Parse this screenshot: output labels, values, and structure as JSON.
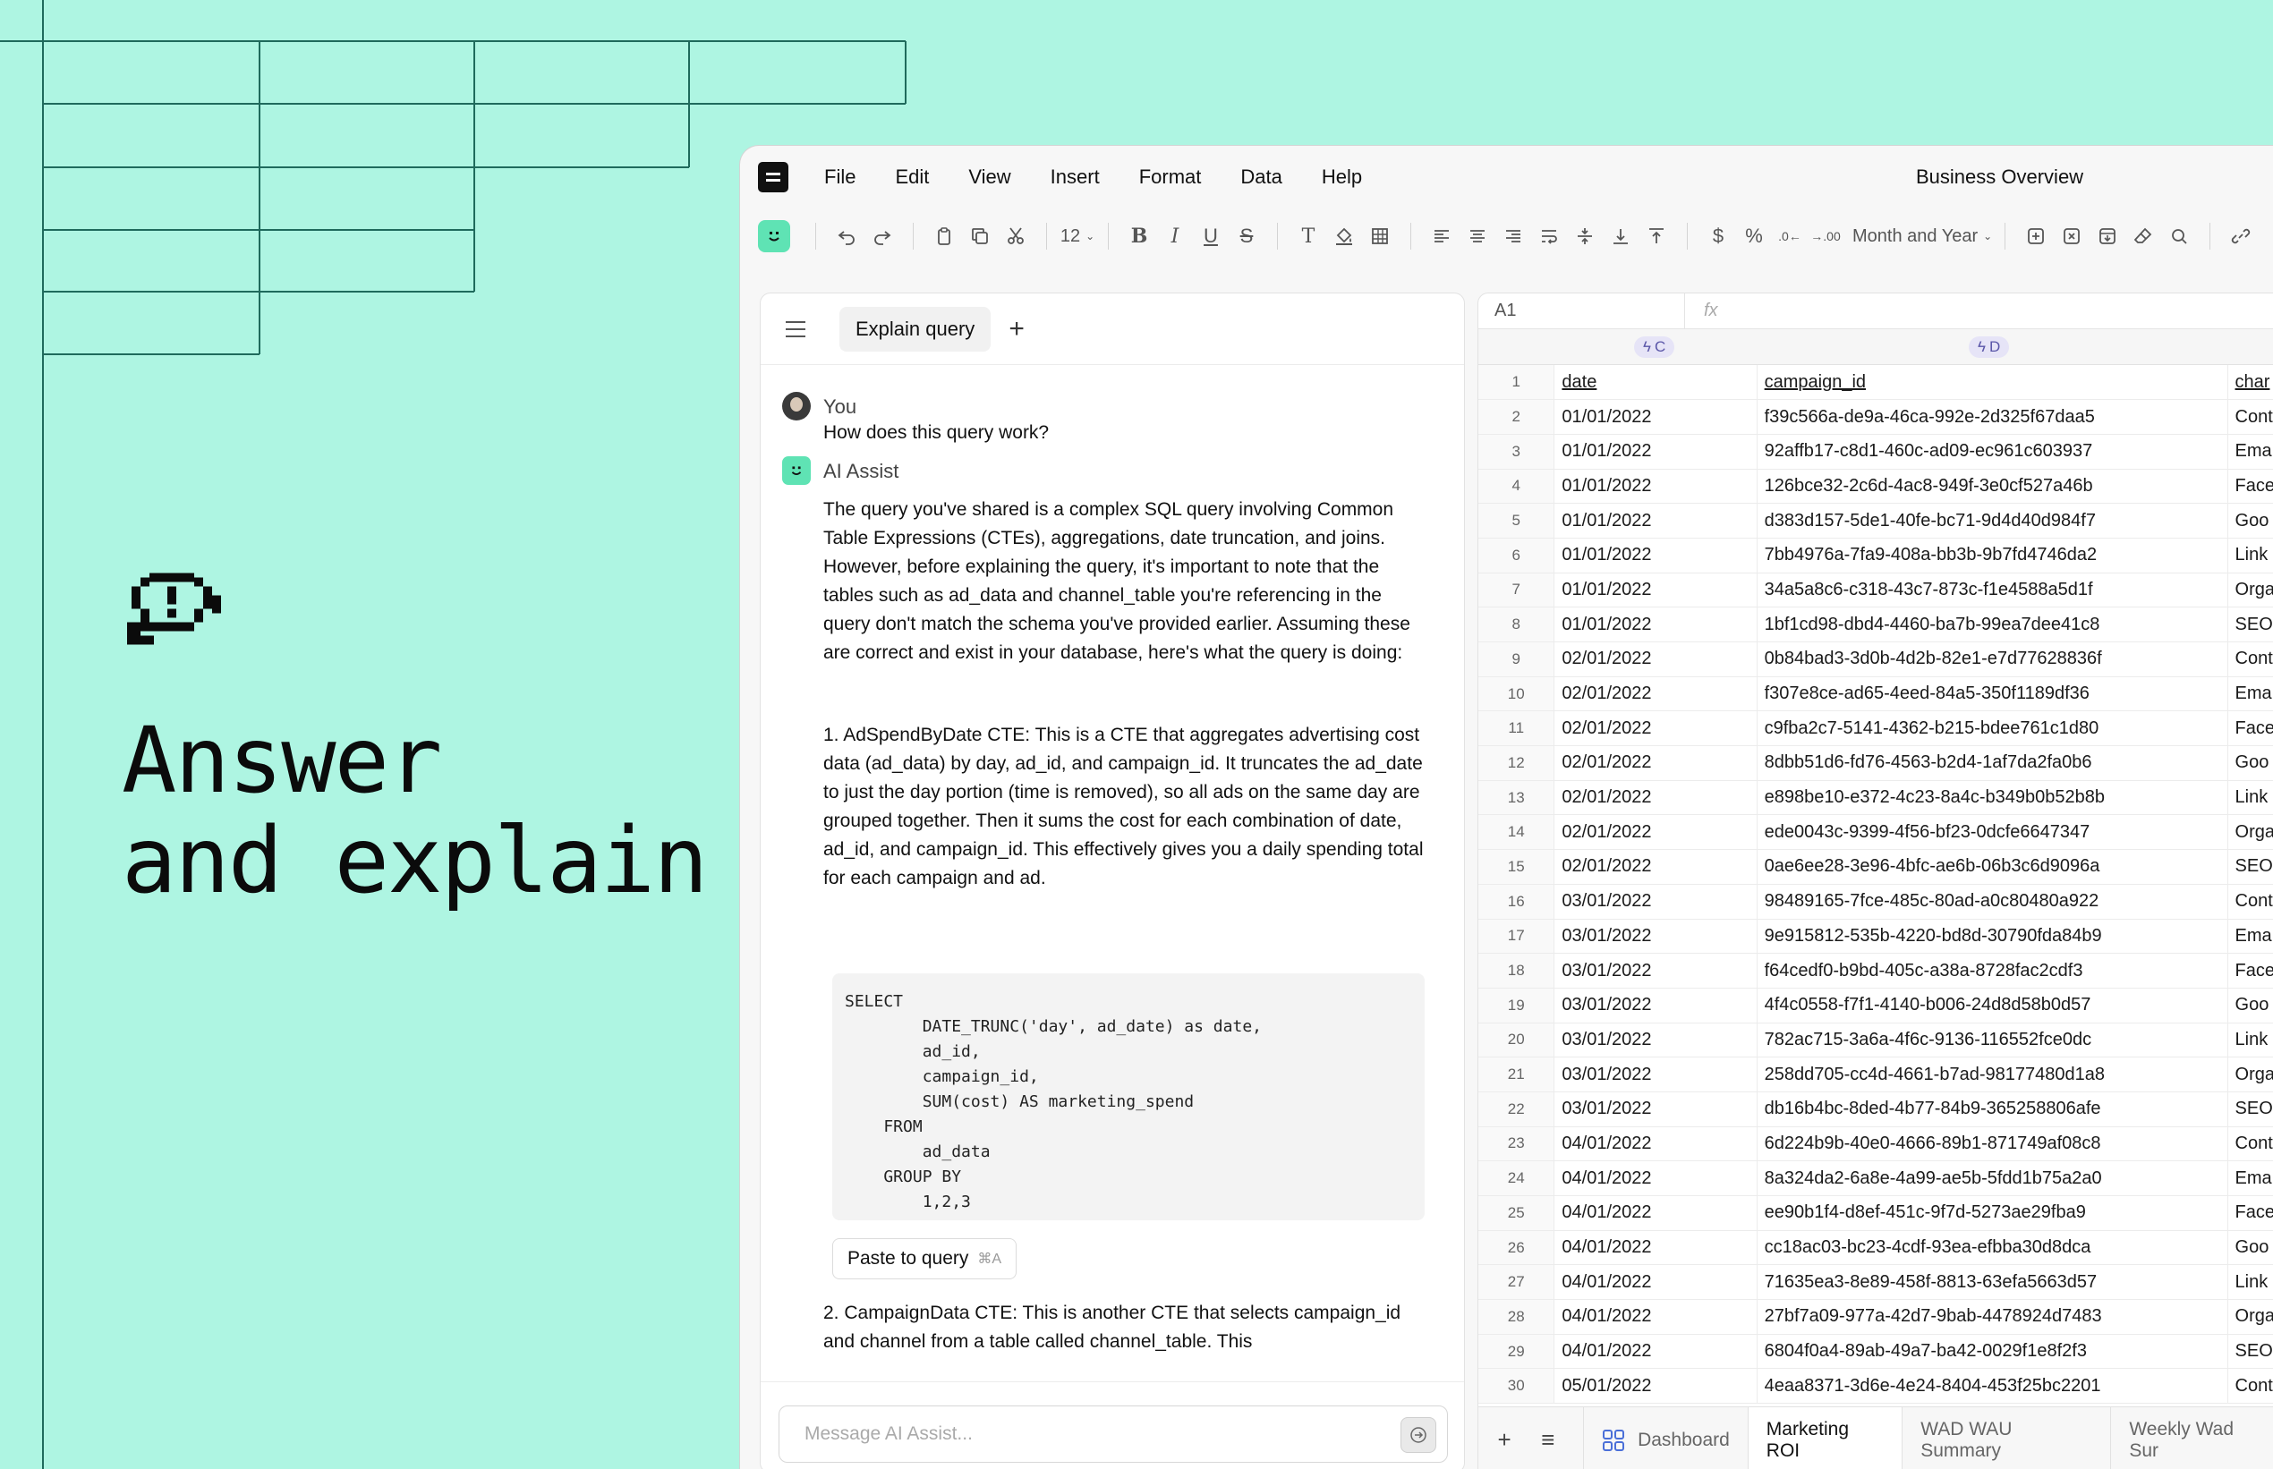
{
  "hero": {
    "title_line1": "Answer",
    "title_line2": "and explain"
  },
  "app": {
    "menu": [
      "File",
      "Edit",
      "View",
      "Insert",
      "Format",
      "Data",
      "Help"
    ],
    "doc_title": "Business Overview",
    "toolbar": {
      "font_size": "12",
      "date_format": "Month and Year"
    }
  },
  "chat": {
    "tab_label": "Explain query",
    "user_name": "You",
    "user_message": "How does this query work?",
    "ai_name": "AI Assist",
    "ai_paragraph1": "The query you've shared is a complex SQL query involving Common Table Expressions (CTEs), aggregations, date truncation, and joins. However, before explaining the query, it's important to note that the tables such as ad_data and channel_table you're referencing in the query don't match the schema you've provided earlier. Assuming these are correct and exist in your database, here's what the query is doing:",
    "ai_paragraph2": "1. AdSpendByDate CTE: This is a CTE that aggregates advertising cost data (ad_data) by day, ad_id, and campaign_id. It truncates the ad_date to just the day portion (time is removed), so all ads on the same day are grouped together. Then it sums the cost for each combination of date, ad_id, and campaign_id. This effectively gives you a daily spending total for each campaign and ad.",
    "code": "SELECT\n        DATE_TRUNC('day', ad_date) as date,\n        ad_id,\n        campaign_id,\n        SUM(cost) AS marketing_spend\n    FROM\n        ad_data\n    GROUP BY\n        1,2,3",
    "paste_label": "Paste to query",
    "paste_shortcut": "⌘A",
    "ai_paragraph3": "2. CampaignData CTE: This is another CTE that selects campaign_id and channel from a table called channel_table. This",
    "input_placeholder": "Message AI Assist..."
  },
  "sheet": {
    "cell_ref": "A1",
    "fx_label": "fx",
    "col_c": "C",
    "col_d": "D",
    "headers": {
      "date": "date",
      "campaign": "campaign_id",
      "channel": "char"
    },
    "rows": [
      [
        "2",
        "01/01/2022",
        "f39c566a-de9a-46ca-992e-2d325f67daa5",
        "Cont"
      ],
      [
        "3",
        "01/01/2022",
        "92affb17-c8d1-460c-ad09-ec961c603937",
        "Ema"
      ],
      [
        "4",
        "01/01/2022",
        "126bce32-2c6d-4ac8-949f-3e0cf527a46b",
        "Face"
      ],
      [
        "5",
        "01/01/2022",
        "d383d157-5de1-40fe-bc71-9d4d40d984f7",
        "Goo"
      ],
      [
        "6",
        "01/01/2022",
        "7bb4976a-7fa9-408a-bb3b-9b7fd4746da2",
        "Link"
      ],
      [
        "7",
        "01/01/2022",
        "34a5a8c6-c318-43c7-873c-f1e4588a5d1f",
        "Orga"
      ],
      [
        "8",
        "01/01/2022",
        "1bf1cd98-dbd4-4460-ba7b-99ea7dee41c8",
        "SEO"
      ],
      [
        "9",
        "02/01/2022",
        "0b84bad3-3d0b-4d2b-82e1-e7d77628836f",
        "Cont"
      ],
      [
        "10",
        "02/01/2022",
        "f307e8ce-ad65-4eed-84a5-350f1189df36",
        "Ema"
      ],
      [
        "11",
        "02/01/2022",
        "c9fba2c7-5141-4362-b215-bdee761c1d80",
        "Face"
      ],
      [
        "12",
        "02/01/2022",
        "8dbb51d6-fd76-4563-b2d4-1af7da2fa0b6",
        "Goo"
      ],
      [
        "13",
        "02/01/2022",
        "e898be10-e372-4c23-8a4c-b349b0b52b8b",
        "Link"
      ],
      [
        "14",
        "02/01/2022",
        "ede0043c-9399-4f56-bf23-0dcfe6647347",
        "Orga"
      ],
      [
        "15",
        "02/01/2022",
        "0ae6ee28-3e96-4bfc-ae6b-06b3c6d9096a",
        "SEO"
      ],
      [
        "16",
        "03/01/2022",
        "98489165-7fce-485c-80ad-a0c80480a922",
        "Cont"
      ],
      [
        "17",
        "03/01/2022",
        "9e915812-535b-4220-bd8d-30790fda84b9",
        "Ema"
      ],
      [
        "18",
        "03/01/2022",
        "f64cedf0-b9bd-405c-a38a-8728fac2cdf3",
        "Face"
      ],
      [
        "19",
        "03/01/2022",
        "4f4c0558-f7f1-4140-b006-24d8d58b0d57",
        "Goo"
      ],
      [
        "20",
        "03/01/2022",
        "782ac715-3a6a-4f6c-9136-116552fce0dc",
        "Link"
      ],
      [
        "21",
        "03/01/2022",
        "258dd705-cc4d-4661-b7ad-98177480d1a8",
        "Orga"
      ],
      [
        "22",
        "03/01/2022",
        "db16b4bc-8ded-4b77-84b9-365258806afe",
        "SEO"
      ],
      [
        "23",
        "04/01/2022",
        "6d224b9b-40e0-4666-89b1-871749af08c8",
        "Cont"
      ],
      [
        "24",
        "04/01/2022",
        "8a324da2-6a8e-4a99-ae5b-5fdd1b75a2a0",
        "Ema"
      ],
      [
        "25",
        "04/01/2022",
        "ee90b1f4-d8ef-451c-9f7d-5273ae29fba9",
        "Face"
      ],
      [
        "26",
        "04/01/2022",
        "cc18ac03-bc23-4cdf-93ea-efbba30d8dca",
        "Goo"
      ],
      [
        "27",
        "04/01/2022",
        "71635ea3-8e89-458f-8813-63efa5663d57",
        "Link"
      ],
      [
        "28",
        "04/01/2022",
        "27bf7a09-977a-42d7-9bab-4478924d7483",
        "Orga"
      ],
      [
        "29",
        "04/01/2022",
        "6804f0a4-89ab-49a7-ba42-0029f1e8f2f3",
        "SEO"
      ],
      [
        "30",
        "05/01/2022",
        "4eaa8371-3d6e-4e24-8404-453f25bc2201",
        "Cont"
      ]
    ],
    "tabs": [
      "Dashboard",
      "Marketing ROI",
      "WAD WAU Summary",
      "Weekly Wad Sur"
    ]
  },
  "colors": {
    "background": "#aef5e2",
    "accent_green": "#5fe3b4",
    "column_chip": "#e6e4f7"
  },
  "icons": [
    "speech-bubble-icon",
    "smiley-icon",
    "undo-icon",
    "redo-icon",
    "clipboard-icon",
    "copy-icon",
    "scissors-icon",
    "bold-icon",
    "italic-icon",
    "underline-icon",
    "strikethrough-icon",
    "search-icon",
    "link-icon",
    "send-arrow-icon",
    "dashboard-grid-icon",
    "menu-icon",
    "plus-icon",
    "lightning-icon"
  ]
}
